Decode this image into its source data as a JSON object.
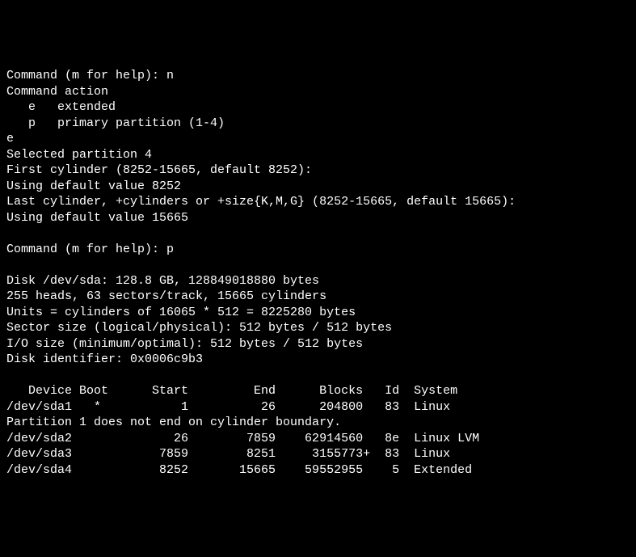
{
  "lines": [
    "Command (m for help): n",
    "Command action",
    "   e   extended",
    "   p   primary partition (1-4)",
    "e",
    "Selected partition 4",
    "First cylinder (8252-15665, default 8252):",
    "Using default value 8252",
    "Last cylinder, +cylinders or +size{K,M,G} (8252-15665, default 15665):",
    "Using default value 15665",
    "",
    "Command (m for help): p",
    "",
    "Disk /dev/sda: 128.8 GB, 128849018880 bytes",
    "255 heads, 63 sectors/track, 15665 cylinders",
    "Units = cylinders of 16065 * 512 = 8225280 bytes",
    "Sector size (logical/physical): 512 bytes / 512 bytes",
    "I/O size (minimum/optimal): 512 bytes / 512 bytes",
    "Disk identifier: 0x0006c9b3",
    "",
    "   Device Boot      Start         End      Blocks   Id  System",
    "/dev/sda1   *           1          26      204800   83  Linux",
    "Partition 1 does not end on cylinder boundary.",
    "/dev/sda2              26        7859    62914560   8e  Linux LVM",
    "/dev/sda3            7859        8251     3155773+  83  Linux",
    "/dev/sda4            8252       15665    59552955    5  Extended"
  ]
}
